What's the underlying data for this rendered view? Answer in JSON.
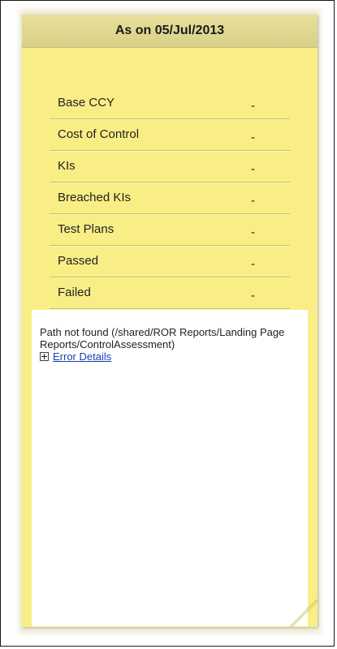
{
  "header": {
    "title": "As on 05/Jul/2013"
  },
  "metrics": [
    {
      "label": "Base CCY",
      "value": "-"
    },
    {
      "label": "Cost of Control",
      "value": "-"
    },
    {
      "label": "KIs",
      "value": "-"
    },
    {
      "label": "Breached KIs",
      "value": "-"
    },
    {
      "label": "Test Plans",
      "value": "-"
    },
    {
      "label": "Passed",
      "value": "-"
    },
    {
      "label": "Failed",
      "value": "-"
    }
  ],
  "error": {
    "message": "Path not found (/shared/ROR Reports/Landing Page Reports/ControlAssessment)",
    "details_link": "Error Details",
    "expand_icon": "plus-box-icon"
  },
  "colors": {
    "note_background": "#f9ee86",
    "header_background": "#ddd58e",
    "link": "#1a3fb4"
  }
}
